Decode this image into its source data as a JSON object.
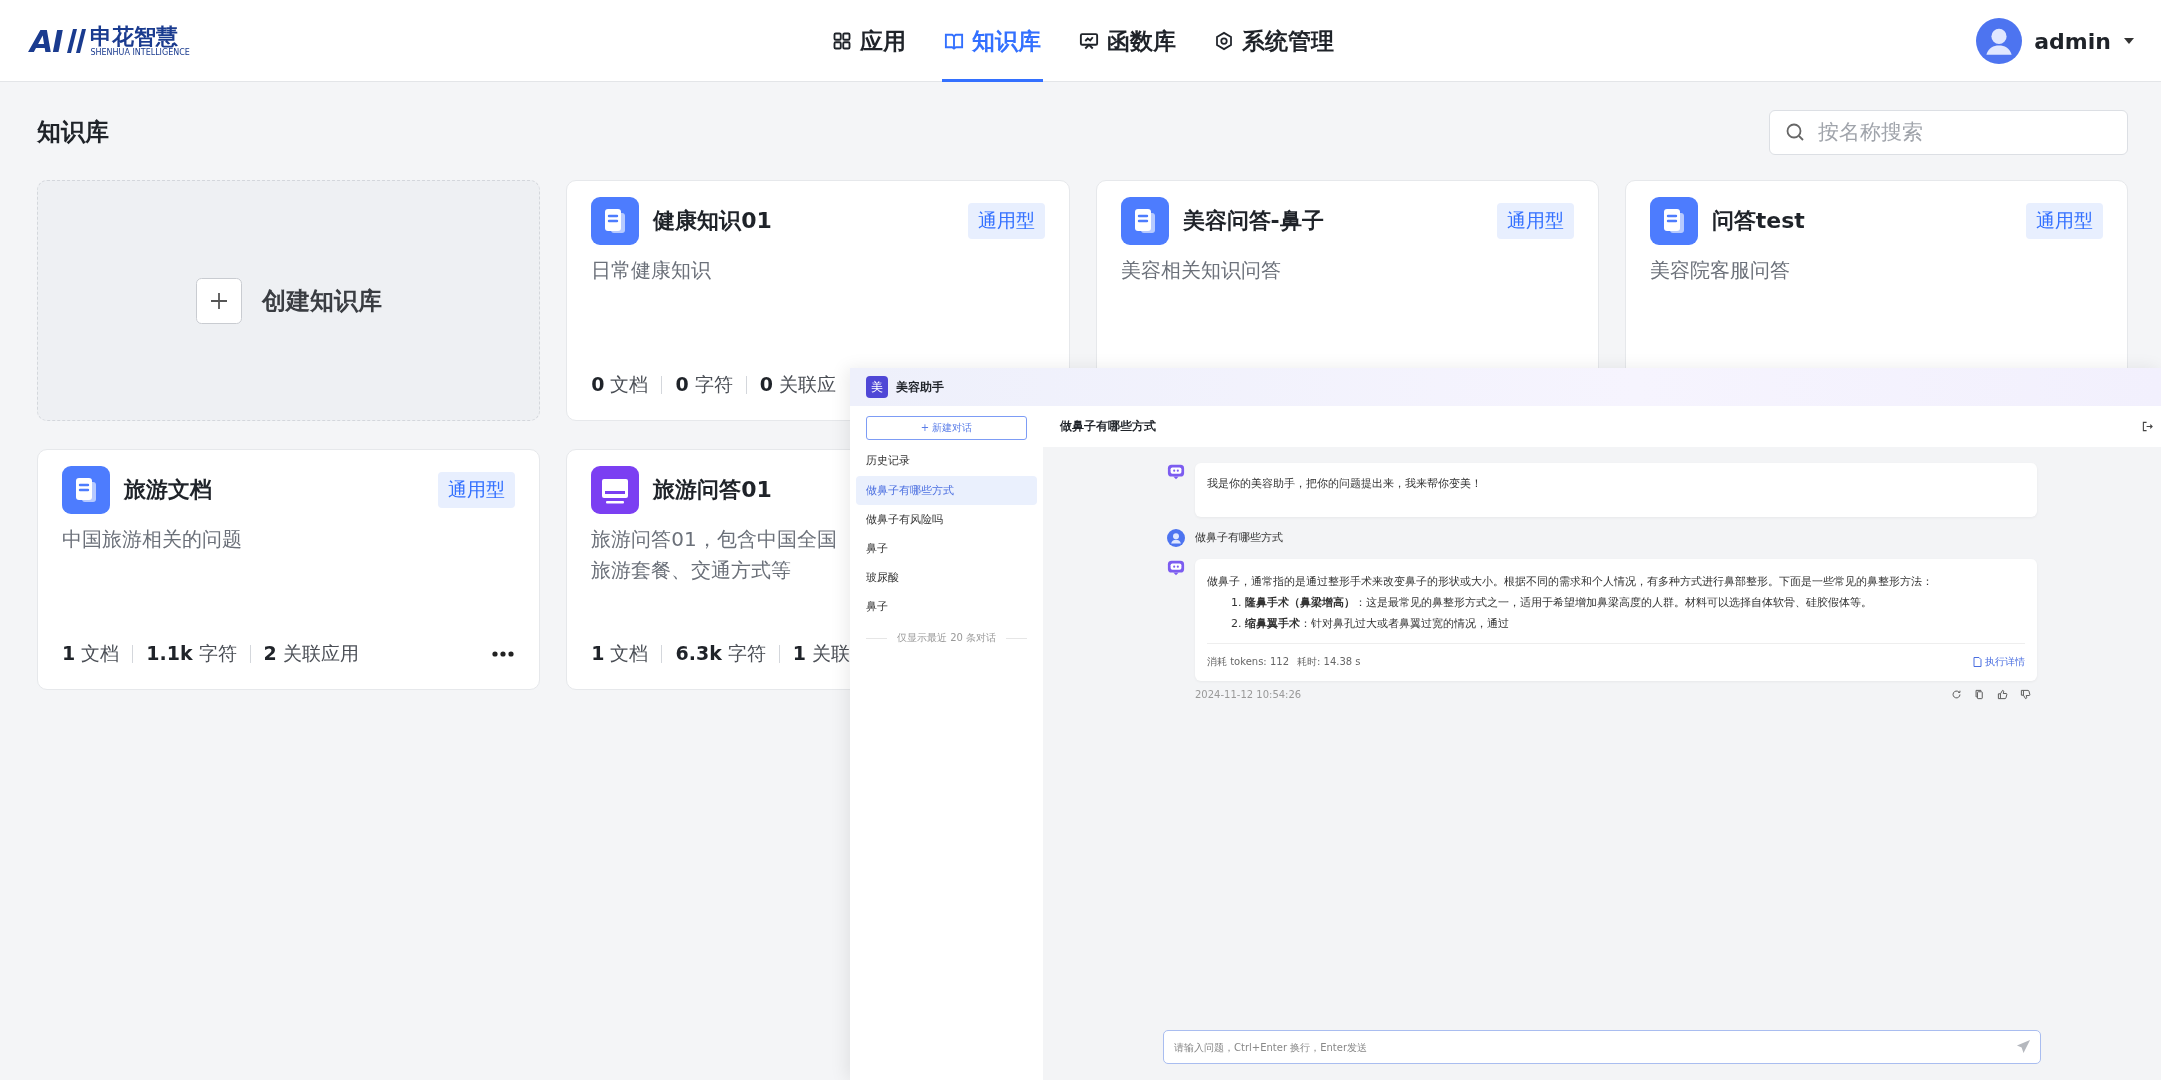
{
  "header": {
    "logo": {
      "mark": "AI",
      "name": "申花智慧",
      "subtitle": "SHENHUA INTELLIGENCE"
    },
    "nav": [
      {
        "label": "应用",
        "kind": "grid",
        "selected": false
      },
      {
        "label": "知识库",
        "kind": "book",
        "selected": true
      },
      {
        "label": "函数库",
        "kind": "board",
        "selected": false
      },
      {
        "label": "系统管理",
        "kind": "gear",
        "selected": false
      }
    ],
    "user": {
      "name": "admin"
    }
  },
  "page": {
    "title": "知识库",
    "search": {
      "placeholder": "按名称搜索"
    },
    "create_card": {
      "label": "创建知识库"
    }
  },
  "knowledge_bases": [
    {
      "name": "健康知识01",
      "tag": "通用型",
      "kind": "document",
      "description_lines": [
        "日常健康知识"
      ],
      "stats": [
        {
          "value": "0",
          "unit": "文档"
        },
        {
          "value": "0",
          "unit": "字符"
        },
        {
          "value": "0",
          "unit": "关联应"
        }
      ]
    },
    {
      "name": "美容问答-鼻子",
      "tag": "通用型",
      "kind": "document",
      "description_lines": [
        "美容相关知识问答"
      ]
    },
    {
      "name": "问答test",
      "tag": "通用型",
      "kind": "document",
      "description_lines": [
        "美容院客服问答"
      ]
    },
    {
      "name": "旅游文档",
      "tag": "通用型",
      "kind": "document",
      "description_lines": [
        "中国旅游相关的问题"
      ],
      "stats": [
        {
          "value": "1",
          "unit": "文档"
        },
        {
          "value": "1.1k",
          "unit": "字符"
        },
        {
          "value": "2",
          "unit": "关联应用"
        }
      ],
      "more_button": true
    },
    {
      "name": "旅游问答01",
      "kind": "monitor",
      "description_lines": [
        "旅游问答01，包含中国全国",
        "旅游套餐、交通方式等"
      ],
      "stats": [
        {
          "value": "1",
          "unit": "文档"
        },
        {
          "value": "6.3k",
          "unit": "字符"
        },
        {
          "value": "1",
          "unit": "关联"
        }
      ]
    }
  ],
  "chat_window": {
    "avatar": "美",
    "title": "美容助手",
    "sidebar": {
      "new_chat": "+ 新建对话",
      "history_label": "历史记录",
      "items": [
        {
          "label": "做鼻子有哪些方式",
          "selected": true
        },
        {
          "label": "做鼻子有风险吗",
          "selected": false
        },
        {
          "label": "鼻子",
          "selected": false
        },
        {
          "label": "玻尿酸",
          "selected": false
        },
        {
          "label": "鼻子",
          "selected": false
        }
      ],
      "footer": "仅显示最近 20 条对话"
    },
    "conversation_title": "做鼻子有哪些方式",
    "messages": [
      {
        "kind": "bot",
        "text": "我是你的美容助手，把你的问题提出来，我来帮你变美！"
      },
      {
        "kind": "user",
        "text": "做鼻子有哪些方式"
      },
      {
        "kind": "bot",
        "text": "做鼻子，通常指的是通过整形手术来改变鼻子的形状或大小。根据不同的需求和个人情况，有多种方式进行鼻部整形。下面是一些常见的鼻整形方法：",
        "list": [
          "1. **隆鼻手术（鼻梁增高）**：这是最常见的鼻整形方式之一，适用于希望增加鼻梁高度的人群。材料可以选择自体软骨、硅胶假体等。",
          "2. **缩鼻翼手术**：针对鼻孔过大或者鼻翼过宽的情况，通过"
        ],
        "usage": [
          "消耗 tokens: 112",
          "耗时: 14.38 s"
        ],
        "details_link": "执行详情",
        "timestamp": "2024-11-12 10:54:26"
      }
    ],
    "input": {
      "placeholder": "请输入问题，Ctrl+Enter 换行，Enter发送"
    }
  }
}
